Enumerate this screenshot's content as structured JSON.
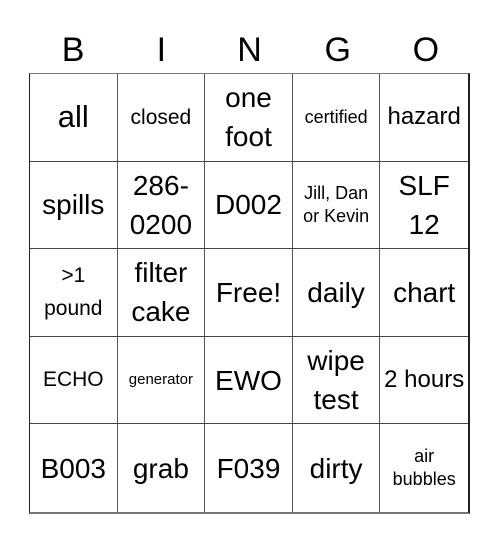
{
  "header": {
    "letters": [
      "B",
      "I",
      "N",
      "G",
      "O"
    ]
  },
  "card": {
    "cells": [
      "all",
      "closed",
      "one foot",
      "certified",
      "hazard",
      "spills",
      "286-0200",
      "D002",
      "Jill, Dan or Kevin",
      "SLF 12",
      ">1 pound",
      "filter cake",
      "Free!",
      "daily",
      "chart",
      "ECHO",
      "generator",
      "EWO",
      "wipe test",
      "2 hours",
      "B003",
      "grab",
      "F039",
      "dirty",
      "air bubbles"
    ],
    "free_space_index": 12
  },
  "colors": {
    "background": "#ffffff",
    "text": "#000000",
    "grid_line": "#555555"
  }
}
